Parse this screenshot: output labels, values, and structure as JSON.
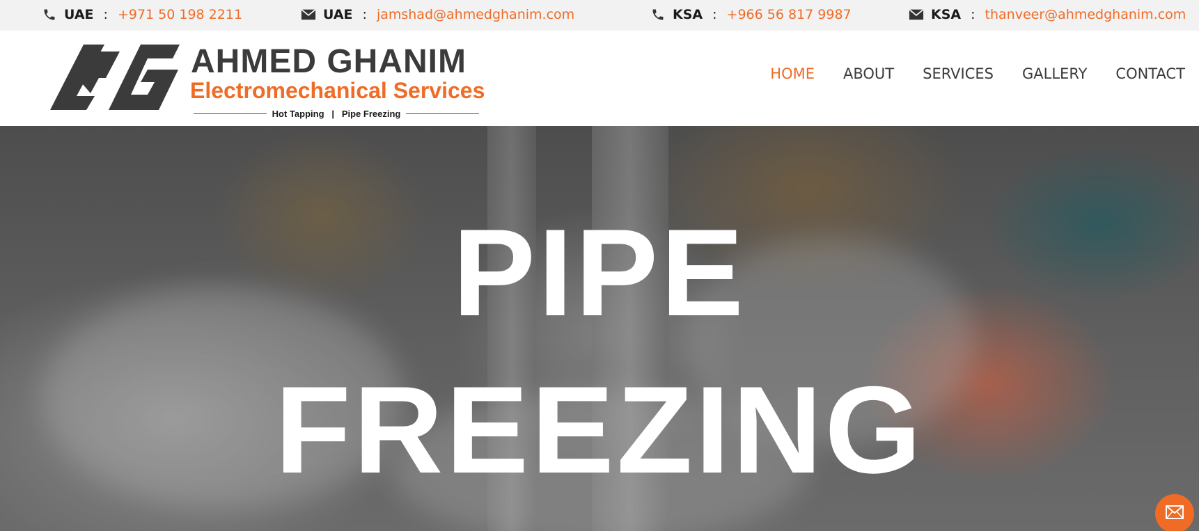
{
  "topbar": {
    "contacts": [
      {
        "icon": "phone-icon",
        "region": "UAE",
        "separator": ":",
        "value": "+971 50 198 2211"
      },
      {
        "icon": "mail-icon",
        "region": "UAE",
        "separator": ":",
        "value": "jamshad@ahmedghanim.com"
      },
      {
        "icon": "phone-icon",
        "region": "KSA",
        "separator": ":",
        "value": "+966 56 817 9987"
      },
      {
        "icon": "mail-icon",
        "region": "KSA",
        "separator": ":",
        "value": "thanveer@ahmedghanim.com"
      }
    ]
  },
  "brand": {
    "name": "AHMED GHANIM",
    "subtitle": "Electromechanical Services",
    "tagline": "Hot Tapping   |   Pipe Freezing"
  },
  "nav": {
    "items": [
      {
        "label": "HOME",
        "active": true
      },
      {
        "label": "ABOUT",
        "active": false
      },
      {
        "label": "SERVICES",
        "active": false
      },
      {
        "label": "GALLERY",
        "active": false
      },
      {
        "label": "CONTACT",
        "active": false
      }
    ]
  },
  "hero": {
    "line1": "PIPE",
    "line2": "FREEZING"
  },
  "fab": {
    "icon": "mail-icon"
  },
  "colors": {
    "accent": "#f06b25",
    "topbar_bg": "#f2f2f2",
    "text_dark": "#3b3b3b"
  }
}
